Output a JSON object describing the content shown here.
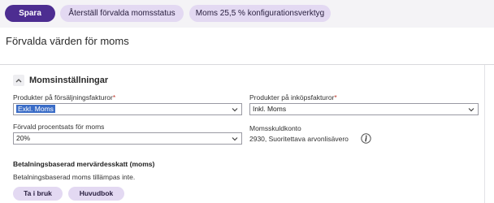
{
  "toolbar": {
    "save_label": "Spara",
    "reset_label": "Återställ förvalda momsstatus",
    "tool_label": "Moms 25,5 % konfigurationsverktyg"
  },
  "page": {
    "title": "Förvalda värden för moms"
  },
  "section": {
    "title": "Momsinställningar",
    "sales_label": "Produkter på försäljningsfakturor",
    "sales_value": "Exkl. Moms",
    "purchase_label": "Produkter på inköpsfakturor",
    "purchase_value": "Inkl. Moms",
    "rate_label": "Förvald procentsats för moms",
    "rate_value": "20%",
    "account_label": "Momsskuldkonto",
    "account_value": "2930, Suoritettava arvonlisävero",
    "required_mark": "*"
  },
  "cash_vat": {
    "title": "Betalningsbaserad mervärdesskatt (moms)",
    "note": "Betalningsbaserad moms tillämpas inte.",
    "enable_label": "Ta i bruk",
    "ledger_label": "Huvudbok"
  },
  "colors": {
    "primary": "#4d2d91",
    "secondary_pill": "#e3d9f2",
    "selection": "#3a6cc7"
  },
  "icons": [
    "chevron-up-icon",
    "chevron-down-icon",
    "info-icon"
  ]
}
